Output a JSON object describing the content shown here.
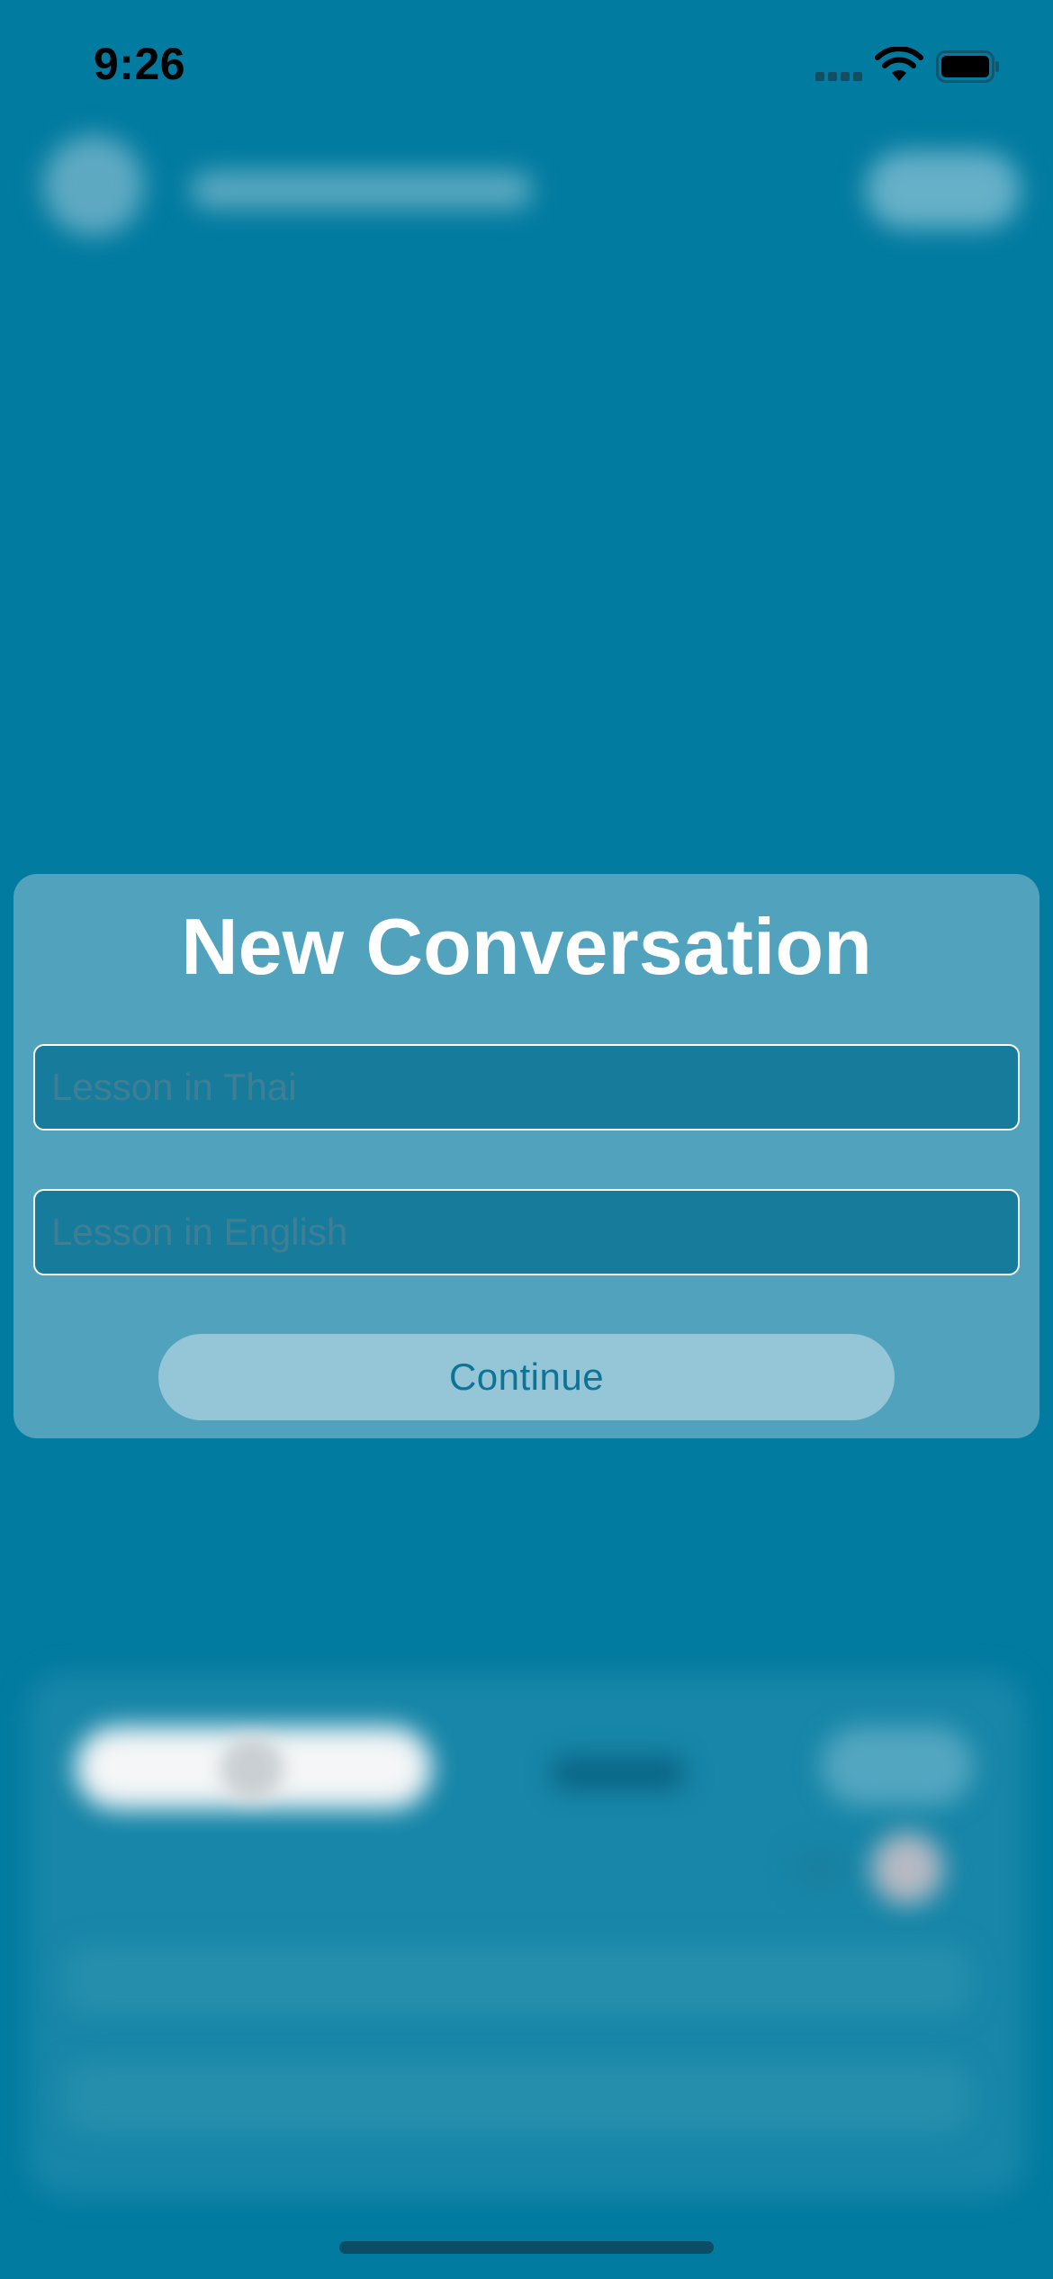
{
  "status_bar": {
    "time": "9:26"
  },
  "modal": {
    "title": "New Conversation",
    "fields": [
      {
        "placeholder": "Lesson in Thai",
        "value": ""
      },
      {
        "placeholder": "Lesson in English",
        "value": ""
      }
    ],
    "continue_label": "Continue"
  },
  "icons": {
    "signal": "cellular-signal-icon",
    "wifi": "wifi-icon",
    "battery": "battery-icon"
  },
  "colors": {
    "background": "#027ba0",
    "modal": "#50a2bd",
    "field": "#177b9b",
    "button": "#95c6d7",
    "button_text": "#0d7397"
  }
}
